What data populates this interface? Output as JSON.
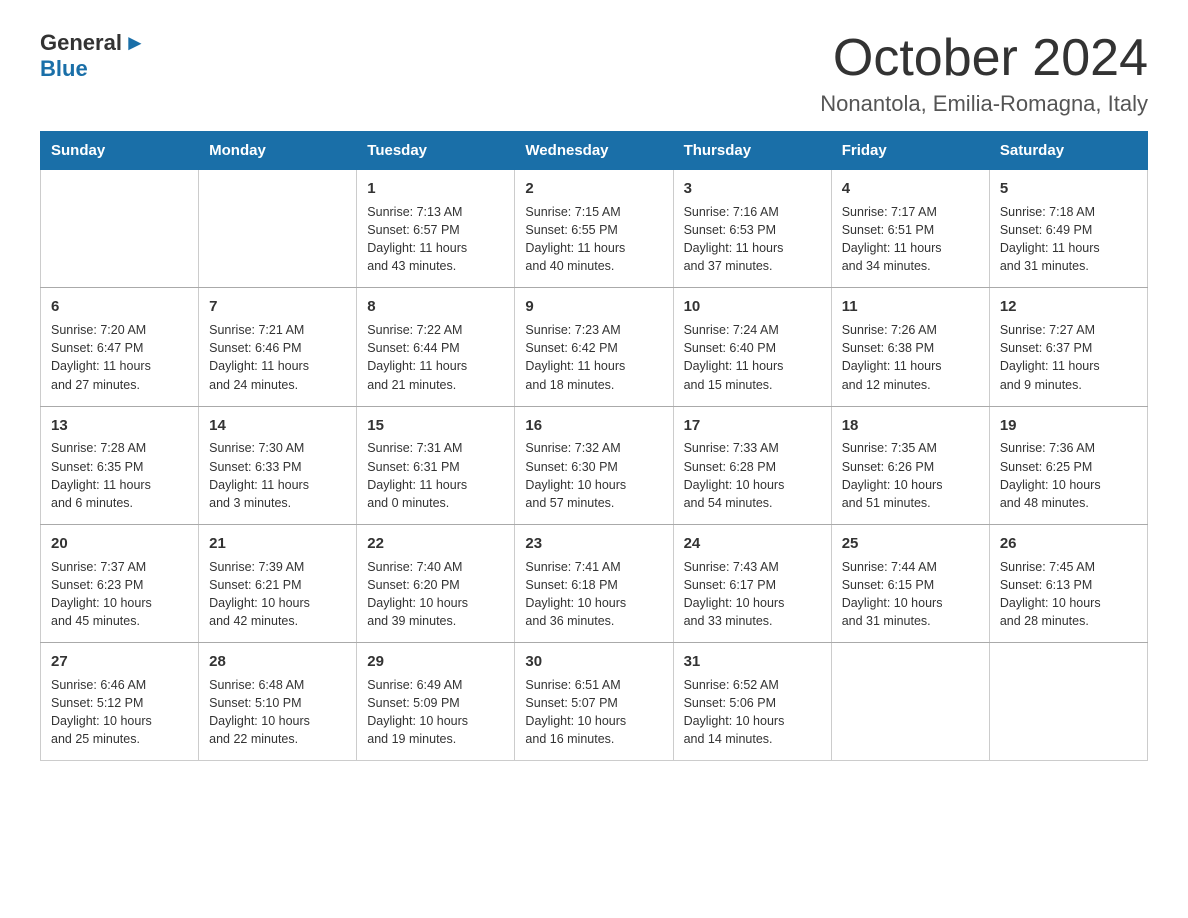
{
  "logo": {
    "general": "General",
    "blue": "Blue",
    "arrow_char": "▶"
  },
  "title": "October 2024",
  "location": "Nonantola, Emilia-Romagna, Italy",
  "header": {
    "days": [
      "Sunday",
      "Monday",
      "Tuesday",
      "Wednesday",
      "Thursday",
      "Friday",
      "Saturday"
    ]
  },
  "weeks": [
    [
      {
        "day": "",
        "info": ""
      },
      {
        "day": "",
        "info": ""
      },
      {
        "day": "1",
        "info": "Sunrise: 7:13 AM\nSunset: 6:57 PM\nDaylight: 11 hours\nand 43 minutes."
      },
      {
        "day": "2",
        "info": "Sunrise: 7:15 AM\nSunset: 6:55 PM\nDaylight: 11 hours\nand 40 minutes."
      },
      {
        "day": "3",
        "info": "Sunrise: 7:16 AM\nSunset: 6:53 PM\nDaylight: 11 hours\nand 37 minutes."
      },
      {
        "day": "4",
        "info": "Sunrise: 7:17 AM\nSunset: 6:51 PM\nDaylight: 11 hours\nand 34 minutes."
      },
      {
        "day": "5",
        "info": "Sunrise: 7:18 AM\nSunset: 6:49 PM\nDaylight: 11 hours\nand 31 minutes."
      }
    ],
    [
      {
        "day": "6",
        "info": "Sunrise: 7:20 AM\nSunset: 6:47 PM\nDaylight: 11 hours\nand 27 minutes."
      },
      {
        "day": "7",
        "info": "Sunrise: 7:21 AM\nSunset: 6:46 PM\nDaylight: 11 hours\nand 24 minutes."
      },
      {
        "day": "8",
        "info": "Sunrise: 7:22 AM\nSunset: 6:44 PM\nDaylight: 11 hours\nand 21 minutes."
      },
      {
        "day": "9",
        "info": "Sunrise: 7:23 AM\nSunset: 6:42 PM\nDaylight: 11 hours\nand 18 minutes."
      },
      {
        "day": "10",
        "info": "Sunrise: 7:24 AM\nSunset: 6:40 PM\nDaylight: 11 hours\nand 15 minutes."
      },
      {
        "day": "11",
        "info": "Sunrise: 7:26 AM\nSunset: 6:38 PM\nDaylight: 11 hours\nand 12 minutes."
      },
      {
        "day": "12",
        "info": "Sunrise: 7:27 AM\nSunset: 6:37 PM\nDaylight: 11 hours\nand 9 minutes."
      }
    ],
    [
      {
        "day": "13",
        "info": "Sunrise: 7:28 AM\nSunset: 6:35 PM\nDaylight: 11 hours\nand 6 minutes."
      },
      {
        "day": "14",
        "info": "Sunrise: 7:30 AM\nSunset: 6:33 PM\nDaylight: 11 hours\nand 3 minutes."
      },
      {
        "day": "15",
        "info": "Sunrise: 7:31 AM\nSunset: 6:31 PM\nDaylight: 11 hours\nand 0 minutes."
      },
      {
        "day": "16",
        "info": "Sunrise: 7:32 AM\nSunset: 6:30 PM\nDaylight: 10 hours\nand 57 minutes."
      },
      {
        "day": "17",
        "info": "Sunrise: 7:33 AM\nSunset: 6:28 PM\nDaylight: 10 hours\nand 54 minutes."
      },
      {
        "day": "18",
        "info": "Sunrise: 7:35 AM\nSunset: 6:26 PM\nDaylight: 10 hours\nand 51 minutes."
      },
      {
        "day": "19",
        "info": "Sunrise: 7:36 AM\nSunset: 6:25 PM\nDaylight: 10 hours\nand 48 minutes."
      }
    ],
    [
      {
        "day": "20",
        "info": "Sunrise: 7:37 AM\nSunset: 6:23 PM\nDaylight: 10 hours\nand 45 minutes."
      },
      {
        "day": "21",
        "info": "Sunrise: 7:39 AM\nSunset: 6:21 PM\nDaylight: 10 hours\nand 42 minutes."
      },
      {
        "day": "22",
        "info": "Sunrise: 7:40 AM\nSunset: 6:20 PM\nDaylight: 10 hours\nand 39 minutes."
      },
      {
        "day": "23",
        "info": "Sunrise: 7:41 AM\nSunset: 6:18 PM\nDaylight: 10 hours\nand 36 minutes."
      },
      {
        "day": "24",
        "info": "Sunrise: 7:43 AM\nSunset: 6:17 PM\nDaylight: 10 hours\nand 33 minutes."
      },
      {
        "day": "25",
        "info": "Sunrise: 7:44 AM\nSunset: 6:15 PM\nDaylight: 10 hours\nand 31 minutes."
      },
      {
        "day": "26",
        "info": "Sunrise: 7:45 AM\nSunset: 6:13 PM\nDaylight: 10 hours\nand 28 minutes."
      }
    ],
    [
      {
        "day": "27",
        "info": "Sunrise: 6:46 AM\nSunset: 5:12 PM\nDaylight: 10 hours\nand 25 minutes."
      },
      {
        "day": "28",
        "info": "Sunrise: 6:48 AM\nSunset: 5:10 PM\nDaylight: 10 hours\nand 22 minutes."
      },
      {
        "day": "29",
        "info": "Sunrise: 6:49 AM\nSunset: 5:09 PM\nDaylight: 10 hours\nand 19 minutes."
      },
      {
        "day": "30",
        "info": "Sunrise: 6:51 AM\nSunset: 5:07 PM\nDaylight: 10 hours\nand 16 minutes."
      },
      {
        "day": "31",
        "info": "Sunrise: 6:52 AM\nSunset: 5:06 PM\nDaylight: 10 hours\nand 14 minutes."
      },
      {
        "day": "",
        "info": ""
      },
      {
        "day": "",
        "info": ""
      }
    ]
  ]
}
